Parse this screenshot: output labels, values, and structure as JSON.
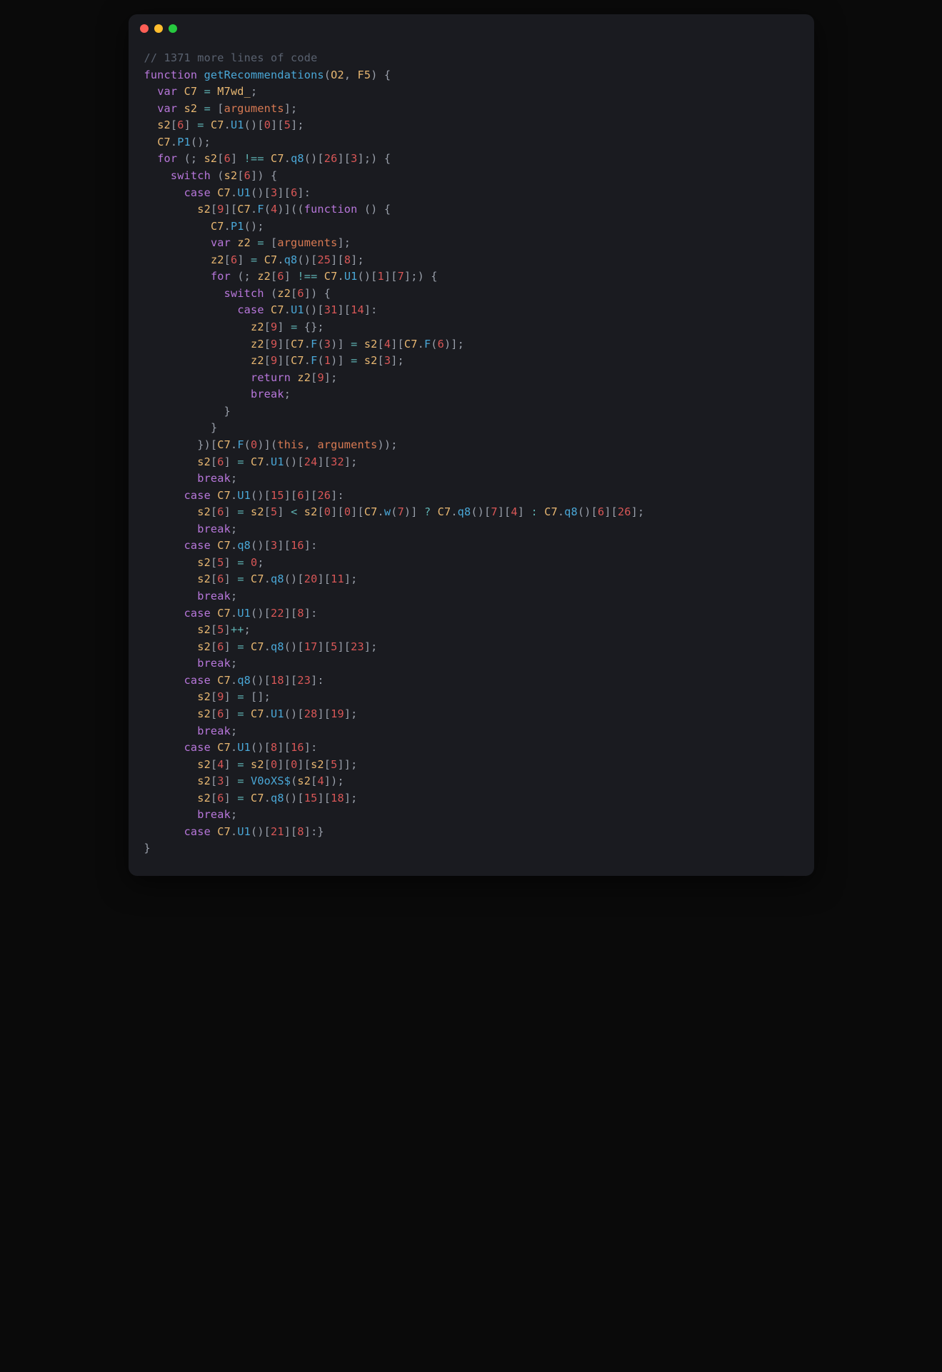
{
  "window": {
    "traffic_lights": [
      "red",
      "yellow",
      "green"
    ]
  },
  "code": {
    "comment": "// 1371 more lines of code",
    "fn_kw": "function",
    "fn_name": "getRecommendations",
    "params": [
      "O2",
      "F5"
    ],
    "var_kw": "var",
    "for_kw": "for",
    "switch_kw": "switch",
    "case_kw": "case",
    "return_kw": "return",
    "break_kw": "break",
    "this_kw": "this",
    "arguments_kw": "arguments",
    "ids": {
      "C7": "C7",
      "s2": "s2",
      "z2": "z2",
      "M7wd_": "M7wd_",
      "V0oXS$": "V0oXS$"
    },
    "methods": {
      "U1": "U1",
      "P1": "P1",
      "q8": "q8",
      "F": "F",
      "w": "w"
    },
    "nums": {
      "n0": "0",
      "n1": "1",
      "n3": "3",
      "n4": "4",
      "n5": "5",
      "n6": "6",
      "n7": "7",
      "n8": "8",
      "n9": "9",
      "n11": "11",
      "n14": "14",
      "n15": "15",
      "n16": "16",
      "n17": "17",
      "n18": "18",
      "n19": "19",
      "n20": "20",
      "n21": "21",
      "n22": "22",
      "n23": "23",
      "n24": "24",
      "n25": "25",
      "n26": "26",
      "n28": "28",
      "n31": "31",
      "n32": "32"
    }
  }
}
